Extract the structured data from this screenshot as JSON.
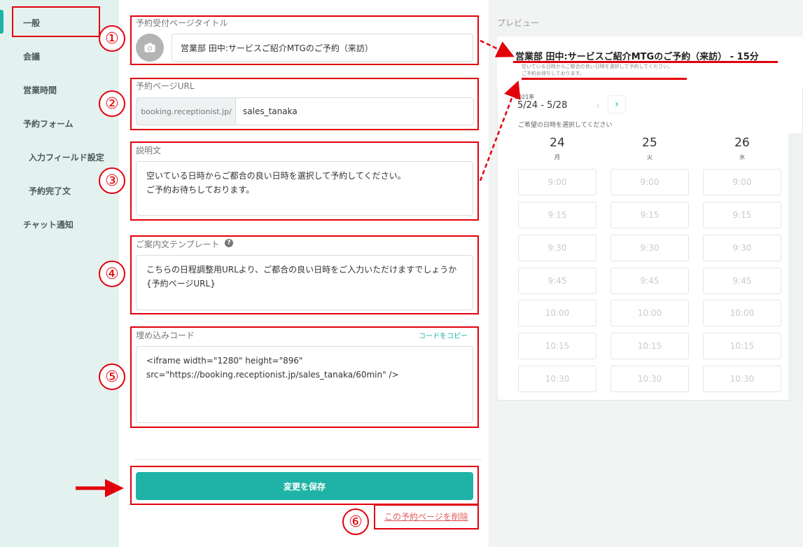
{
  "sidebar": {
    "items": [
      {
        "label": "一般"
      },
      {
        "label": "会議"
      },
      {
        "label": "営業時間"
      },
      {
        "label": "予約フォーム"
      },
      {
        "label": "入力フィールド設定"
      },
      {
        "label": "予約完了文"
      },
      {
        "label": "チャット通知"
      }
    ]
  },
  "form": {
    "title_label": "予約受付ページタイトル",
    "title_value": "営業部 田中:サービスご紹介MTGのご予約（来訪）",
    "url_label": "予約ページURL",
    "url_prefix": "booking.receptionist.jp/",
    "url_value": "sales_tanaka",
    "desc_label": "説明文",
    "desc_lines": [
      "空いている日時からご都合の良い日時を選択して予約してください。",
      "ご予約お待ちしております。"
    ],
    "template_label": "ご案内文テンプレート",
    "template_lines": [
      "こちらの日程調整用URLより、ご都合の良い日時をご入力いただけますでしょうか",
      "{予約ページURL}"
    ],
    "embed_label": "埋め込みコード",
    "copy_label": "コードをコピー",
    "embed_lines": [
      "<iframe width=\"1280\" height=\"896\"",
      "src=\"https://booking.receptionist.jp/sales_tanaka/60min\" />"
    ],
    "save_label": "変更を保存",
    "delete_label": "この予約ページを削除"
  },
  "preview": {
    "label": "プレビュー",
    "title": "営業部 田中:サービスご紹介MTGのご予約（来訪） - 15分",
    "desc_lines": [
      "空いている日時からご都合の良い日時を選択して予約してください。",
      "ご予約お待ちしております。"
    ],
    "year": "2021年",
    "range": "5/24 - 5/28",
    "hint": "ご希望の日時を選択してください",
    "days": [
      {
        "num": "24",
        "weekday": "月"
      },
      {
        "num": "25",
        "weekday": "火"
      },
      {
        "num": "26",
        "weekday": "水"
      }
    ],
    "slots": [
      "9:00",
      "9:15",
      "9:30",
      "9:45",
      "10:00",
      "10:15",
      "10:30"
    ]
  },
  "annotations": {
    "markers": [
      "①",
      "②",
      "③",
      "④",
      "⑤",
      "⑥"
    ]
  },
  "colors": {
    "accent": "#1fb3a7",
    "annotation": "#e3000b",
    "delete": "#e35a5a"
  }
}
